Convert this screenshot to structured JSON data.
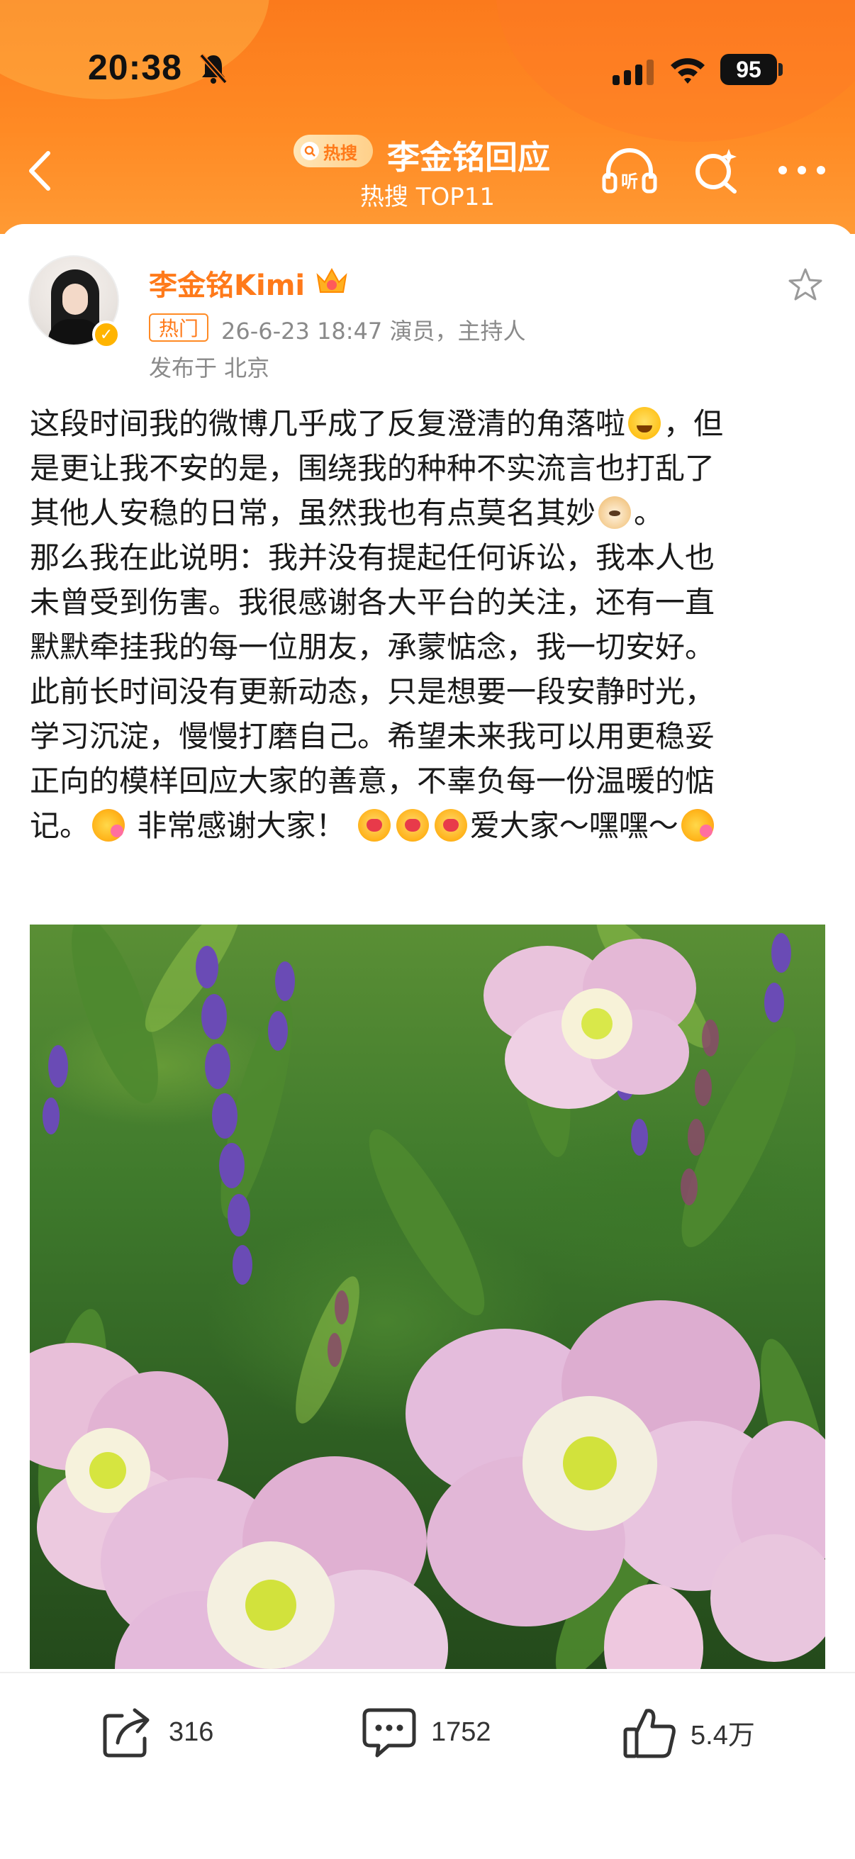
{
  "status_bar": {
    "time": "20:38",
    "battery": "95"
  },
  "nav": {
    "hot_badge": "热搜",
    "title": "李金铭回应",
    "subtitle": "热搜 TOP11"
  },
  "post": {
    "username": "李金铭Kimi",
    "tag": "热门",
    "meta": "26-6-23 18:47  演员，主持人",
    "location": "发布于 北京",
    "lines": [
      [
        "这段时间我的微博几乎成了反复澄清的角落啦",
        "laugh",
        "，但"
      ],
      [
        "是更让我不安的是，围绕我的种种不实流言也打乱了"
      ],
      [
        "其他人安稳的日常，虽然我也有点莫名其妙",
        "dog",
        "。"
      ],
      [
        "那么我在此说明：我并没有提起任何诉讼，我本人也"
      ],
      [
        "未曾受到伤害。我很感谢各大平台的关注，还有一直"
      ],
      [
        "默默牵挂我的每一位朋友，承蒙惦念，我一切安好。"
      ],
      [
        "此前长时间没有更新动态，只是想要一段安静时光，"
      ],
      [
        "学习沉淀，慢慢打磨自己。希望未来我可以用更稳妥"
      ],
      [
        "正向的模样回应大家的善意，不辜负每一份温暖的惦"
      ],
      [
        "记。",
        "flower",
        " 非常感谢大家！ ",
        "love",
        "love",
        "love",
        "爱大家～嘿嘿～",
        "flower"
      ]
    ]
  },
  "actions": {
    "share": "316",
    "comment": "1752",
    "like": "5.4万"
  }
}
